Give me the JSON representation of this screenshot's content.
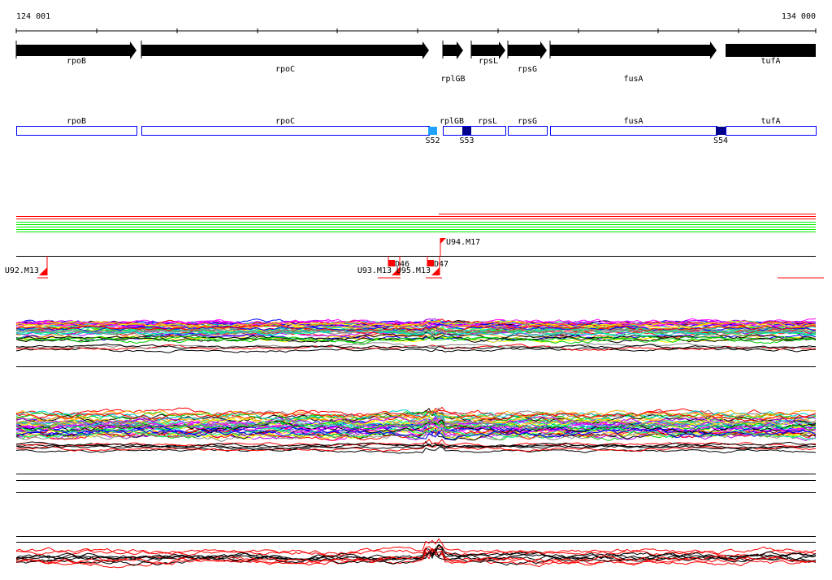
{
  "ruler": {
    "start_label": "124 001",
    "end_label": "134 000"
  },
  "genes": [
    {
      "name": "rpoB"
    },
    {
      "name": "rpoC"
    },
    {
      "name": "rplGB"
    },
    {
      "name": "rpsL"
    },
    {
      "name": "rpsG"
    },
    {
      "name": "fusA"
    },
    {
      "name": "tufA"
    }
  ],
  "features": [
    {
      "label": "S52",
      "color": "#1fa3ff"
    },
    {
      "label": "S53",
      "color": "#00008b"
    },
    {
      "label": "S54",
      "color": "#00008b"
    }
  ],
  "primers": [
    {
      "label": "U92.M13"
    },
    {
      "label": "D46"
    },
    {
      "label": "U93.M13"
    },
    {
      "label": "U95.M13"
    },
    {
      "label": "D47"
    },
    {
      "label": "U94.M17"
    }
  ],
  "colors": {
    "box_outline": "#0000ff",
    "primer": "#ff0000",
    "track_red": "#ff0000",
    "track_green": "#00ee00"
  }
}
